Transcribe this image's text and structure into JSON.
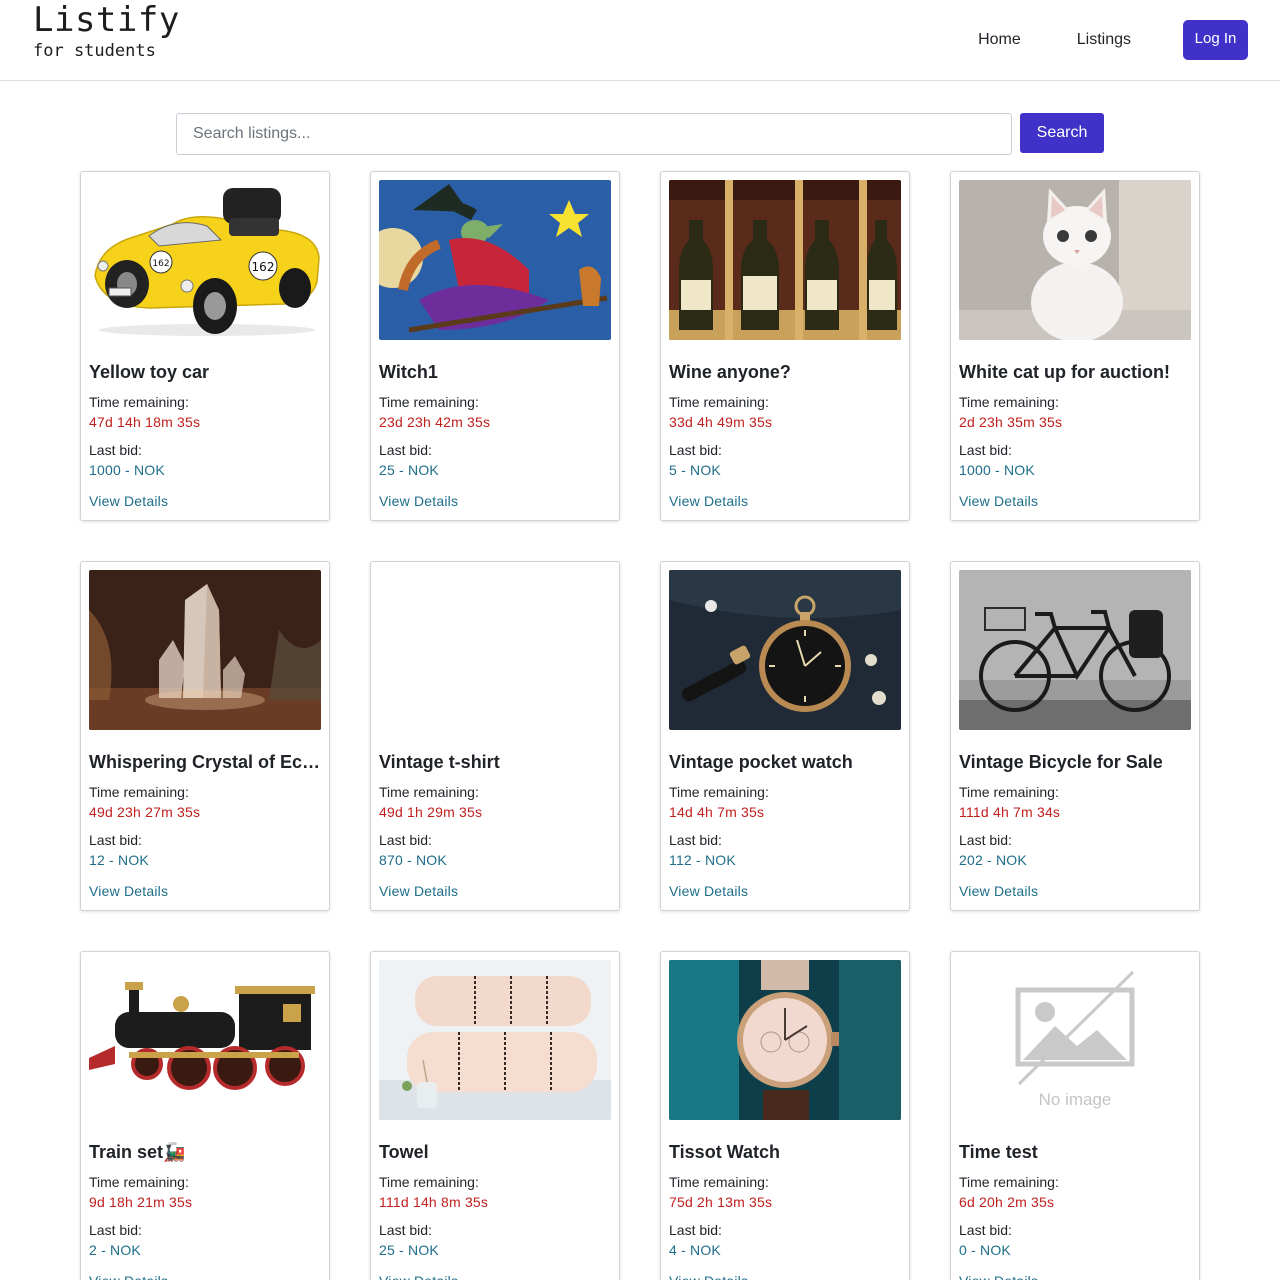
{
  "theme": {
    "accent": "#4032c8",
    "danger": "#c0201e",
    "teal": "#1e6e89"
  },
  "brand": {
    "title": "Listify",
    "subtitle": "for students"
  },
  "nav": {
    "home": "Home",
    "listings": "Listings",
    "login": "Log In"
  },
  "search": {
    "placeholder": "Search listings...",
    "button": "Search"
  },
  "labels": {
    "time_remaining": "Time remaining:",
    "last_bid": "Last bid:",
    "view_details": "View Details"
  },
  "listings": [
    {
      "title": "Yellow toy car",
      "time": "47d 14h 18m 35s",
      "bid": "1000 - NOK",
      "image": "toy-car"
    },
    {
      "title": "Witch1",
      "time": "23d 23h 42m 35s",
      "bid": "25 - NOK",
      "image": "witch"
    },
    {
      "title": "Wine anyone?",
      "time": "33d 4h 49m 35s",
      "bid": "5 - NOK",
      "image": "wine"
    },
    {
      "title": "White cat up for auction!",
      "time": "2d 23h 35m 35s",
      "bid": "1000 - NOK",
      "image": "cat"
    },
    {
      "title": "Whispering Crystal of Echoes",
      "time": "49d 23h 27m 35s",
      "bid": "12 - NOK",
      "image": "crystal"
    },
    {
      "title": "Vintage t-shirt",
      "time": "49d 1h 29m 35s",
      "bid": "870 - NOK",
      "image": "none"
    },
    {
      "title": "Vintage pocket watch",
      "time": "14d 4h 7m 35s",
      "bid": "112 - NOK",
      "image": "pocket-watch"
    },
    {
      "title": "Vintage Bicycle for Sale",
      "time": "111d 4h 7m 34s",
      "bid": "202 - NOK",
      "image": "bicycle"
    },
    {
      "title": "Train set🚂",
      "time": "9d 18h 21m 35s",
      "bid": "2 - NOK",
      "image": "train"
    },
    {
      "title": "Towel",
      "time": "111d 14h 8m 35s",
      "bid": "25 - NOK",
      "image": "towel"
    },
    {
      "title": "Tissot Watch",
      "time": "75d 2h 13m 35s",
      "bid": "4 - NOK",
      "image": "wrist-watch"
    },
    {
      "title": "Time test",
      "time": "6d 20h 2m 35s",
      "bid": "0 - NOK",
      "image": "no-image"
    }
  ],
  "no_image_text": "No image"
}
